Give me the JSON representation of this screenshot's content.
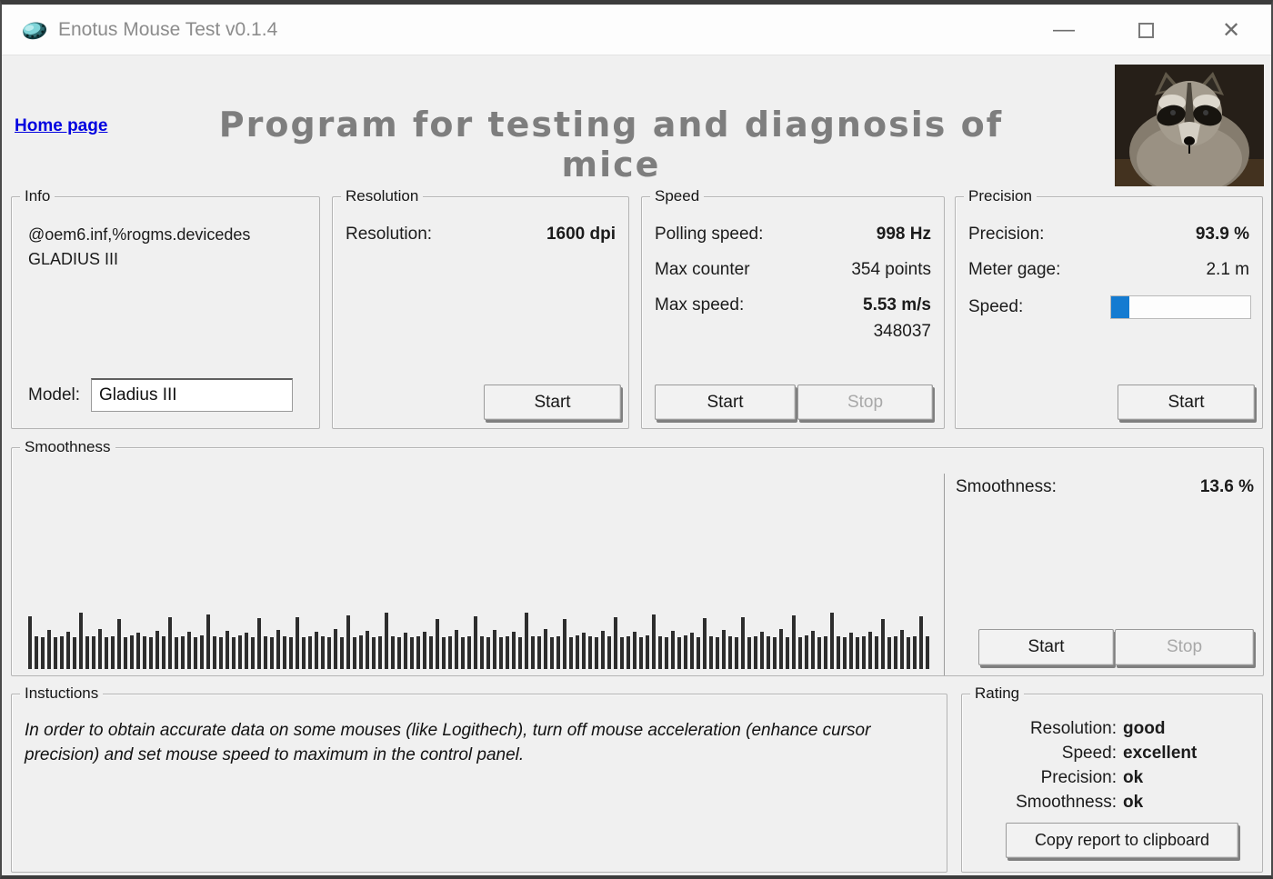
{
  "window": {
    "title": "Enotus Mouse Test v0.1.4",
    "controls": {
      "minimize": "—",
      "close": "✕"
    }
  },
  "header": {
    "home_link": "Home page",
    "title": "Program for testing and diagnosis of mice"
  },
  "info": {
    "legend": "Info",
    "device_line1": "@oem6.inf,%rogms.devicedes",
    "device_line2": "GLADIUS III",
    "model_label": "Model:",
    "model_value": "Gladius III"
  },
  "resolution": {
    "legend": "Resolution",
    "label": "Resolution:",
    "value": "1600 dpi",
    "start_label": "Start"
  },
  "speed": {
    "legend": "Speed",
    "polling_label": "Polling speed:",
    "polling_value": "998 Hz",
    "counter_label": "Max counter",
    "counter_value": "354 points",
    "maxspeed_label": "Max speed:",
    "maxspeed_value": "5.53 m/s",
    "counter_raw": "348037",
    "start_label": "Start",
    "stop_label": "Stop"
  },
  "precision": {
    "legend": "Precision",
    "precision_label": "Precision:",
    "precision_value": "93.9 %",
    "meter_label": "Meter gage:",
    "meter_value": "2.1 m",
    "speed_label": "Speed:",
    "progress_percent": 13,
    "start_label": "Start"
  },
  "smoothness": {
    "legend": "Smoothness",
    "label": "Smoothness:",
    "value": "13.6 %",
    "start_label": "Start",
    "stop_label": "Stop",
    "bars": [
      58,
      36,
      35,
      43,
      35,
      36,
      41,
      35,
      62,
      36,
      36,
      44,
      35,
      36,
      55,
      35,
      37,
      40,
      36,
      35,
      42,
      36,
      57,
      35,
      36,
      41,
      35,
      37,
      60,
      36,
      35,
      42,
      35,
      37,
      40,
      35,
      56,
      36,
      35,
      43,
      36,
      35,
      57,
      35,
      36,
      41,
      36,
      35,
      44,
      35,
      59,
      35,
      37,
      42,
      35,
      36,
      62,
      36,
      35,
      40,
      35,
      36,
      41,
      36,
      55,
      35,
      36,
      43,
      35,
      36,
      58,
      36,
      35,
      43,
      35,
      36,
      41,
      35,
      62,
      36,
      36,
      44,
      35,
      36,
      55,
      35,
      37,
      40,
      36,
      35,
      42,
      36,
      57,
      35,
      36,
      41,
      35,
      37,
      60,
      36,
      35,
      42,
      35,
      37,
      40,
      35,
      56,
      36,
      35,
      43,
      36,
      35,
      57,
      35,
      36,
      41,
      36,
      35,
      44,
      35,
      59,
      35,
      37,
      42,
      35,
      36,
      62,
      36,
      35,
      40,
      35,
      36,
      41,
      36,
      55,
      35,
      36,
      43,
      35,
      36,
      58,
      36
    ]
  },
  "instructions": {
    "legend": "Instuctions",
    "text": "In order to obtain accurate data on some mouses (like Logithech), turn off mouse acceleration (enhance cursor precision) and set mouse speed to maximum in the control panel."
  },
  "rating": {
    "legend": "Rating",
    "rows": [
      {
        "label": "Resolution:",
        "value": "good"
      },
      {
        "label": "Speed:",
        "value": "excellent"
      },
      {
        "label": "Precision:",
        "value": "ok"
      },
      {
        "label": "Smoothness:",
        "value": "ok"
      }
    ],
    "copy_button": "Copy report to clipboard"
  },
  "colors": {
    "accent_blue": "#147bd1",
    "link_blue": "#0000e0"
  }
}
